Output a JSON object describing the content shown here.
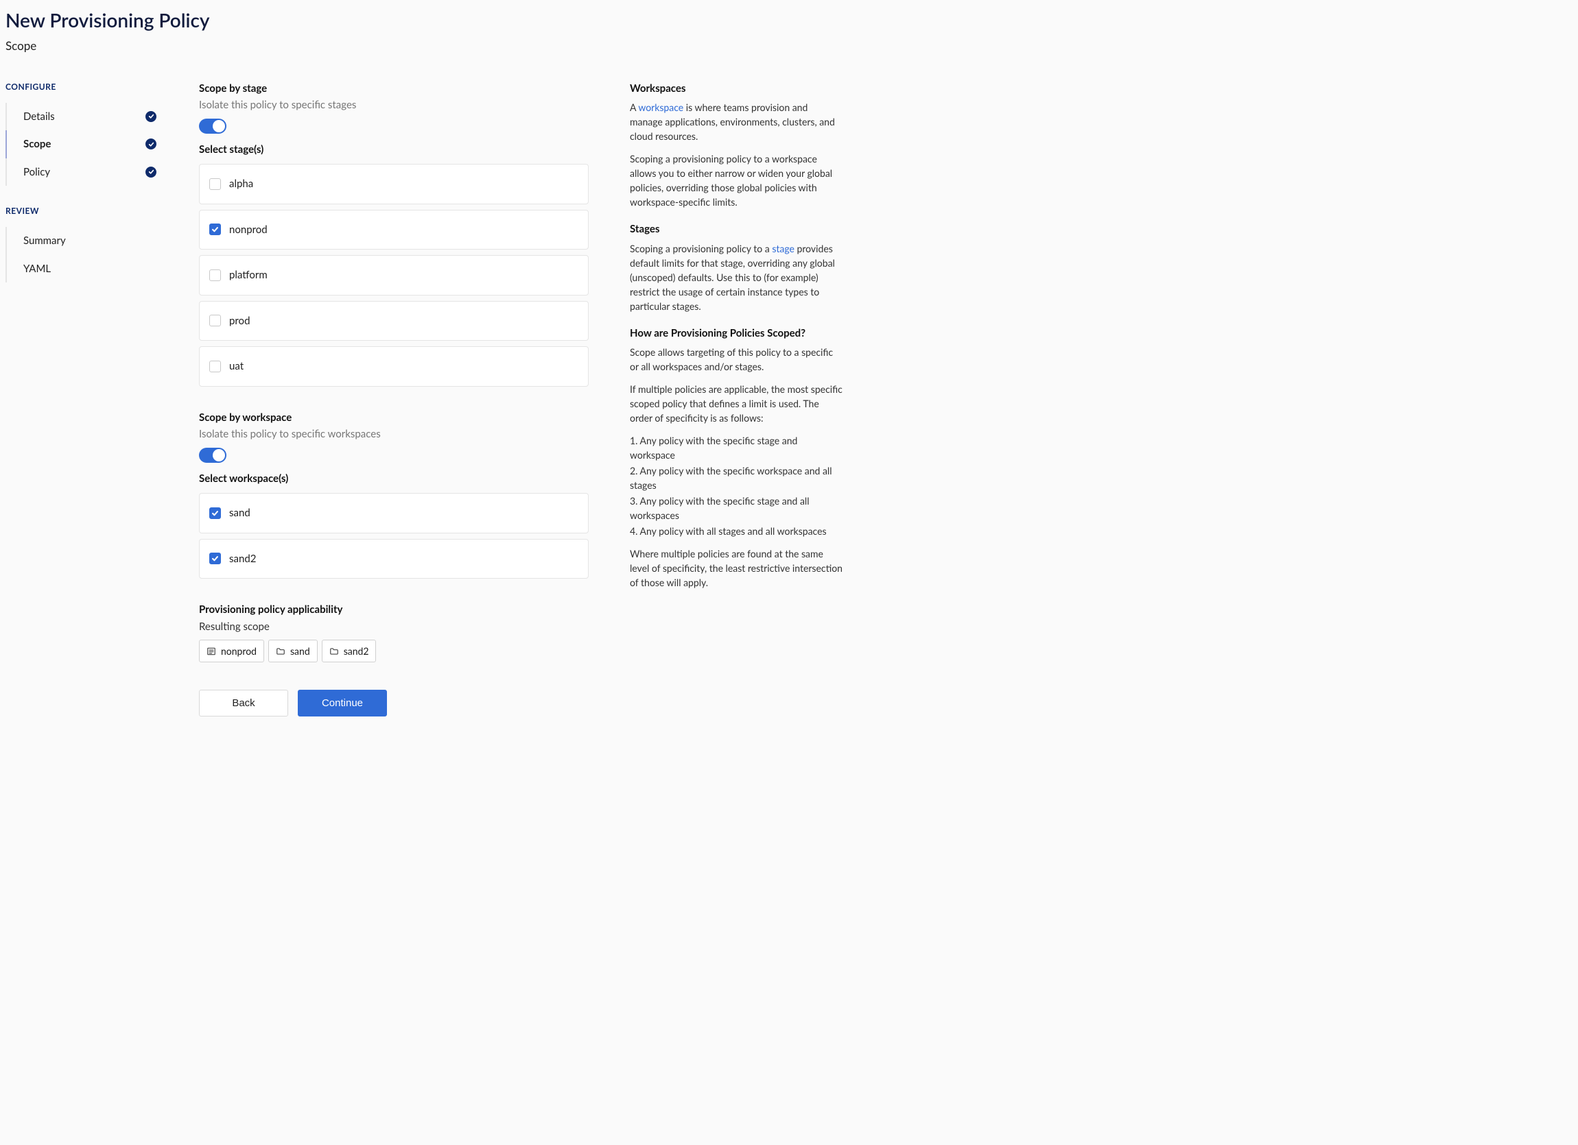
{
  "header": {
    "title": "New Provisioning Policy",
    "subtitle": "Scope"
  },
  "sidebar": {
    "sections": [
      {
        "label": "CONFIGURE",
        "items": [
          {
            "label": "Details",
            "checked": true,
            "active": false
          },
          {
            "label": "Scope",
            "checked": true,
            "active": true
          },
          {
            "label": "Policy",
            "checked": true,
            "active": false
          }
        ]
      },
      {
        "label": "REVIEW",
        "items": [
          {
            "label": "Summary",
            "checked": false,
            "active": false
          },
          {
            "label": "YAML",
            "checked": false,
            "active": false
          }
        ]
      }
    ]
  },
  "main": {
    "stage": {
      "title": "Scope by stage",
      "desc": "Isolate this policy to specific stages",
      "toggle_on": true,
      "select_label": "Select stage(s)",
      "options": [
        {
          "label": "alpha",
          "checked": false
        },
        {
          "label": "nonprod",
          "checked": true
        },
        {
          "label": "platform",
          "checked": false
        },
        {
          "label": "prod",
          "checked": false
        },
        {
          "label": "uat",
          "checked": false
        }
      ]
    },
    "workspace": {
      "title": "Scope by workspace",
      "desc": "Isolate this policy to specific workspaces",
      "toggle_on": true,
      "select_label": "Select workspace(s)",
      "options": [
        {
          "label": "sand",
          "checked": true
        },
        {
          "label": "sand2",
          "checked": true
        }
      ]
    },
    "applicability": {
      "title": "Provisioning policy applicability",
      "subtitle": "Resulting scope",
      "chips": [
        {
          "icon": "stage",
          "label": "nonprod"
        },
        {
          "icon": "folder",
          "label": "sand"
        },
        {
          "icon": "folder",
          "label": "sand2"
        }
      ]
    },
    "buttons": {
      "back": "Back",
      "continue": "Continue"
    }
  },
  "help": {
    "h1": "Workspaces",
    "p1a": "A ",
    "p1_link": "workspace",
    "p1b": " is where teams provision and manage applications, environments, clusters, and cloud resources.",
    "p2": "Scoping a provisioning policy to a workspace allows you to either narrow or widen your global policies, overriding those global policies with workspace-specific limits.",
    "h2": "Stages",
    "p3a": "Scoping a provisioning policy to a ",
    "p3_link": "stage",
    "p3b": " provides default limits for that stage, overriding any global (unscoped) defaults. Use this to (for example) restrict the usage of certain instance types to particular stages.",
    "h3": "How are Provisioning Policies Scoped?",
    "p4": "Scope allows targeting of this policy to a specific or all workspaces and/or stages.",
    "p5": "If multiple policies are applicable, the most specific scoped policy that defines a limit is used. The order of specificity is as follows:",
    "ol": [
      "1. Any policy with the specific stage and workspace",
      "2. Any policy with the specific workspace and all stages",
      "3. Any policy with the specific stage and all workspaces",
      "4. Any policy with all stages and all workspaces"
    ],
    "p6": "Where multiple policies are found at the same level of specificity, the least restrictive intersection of those will apply."
  }
}
